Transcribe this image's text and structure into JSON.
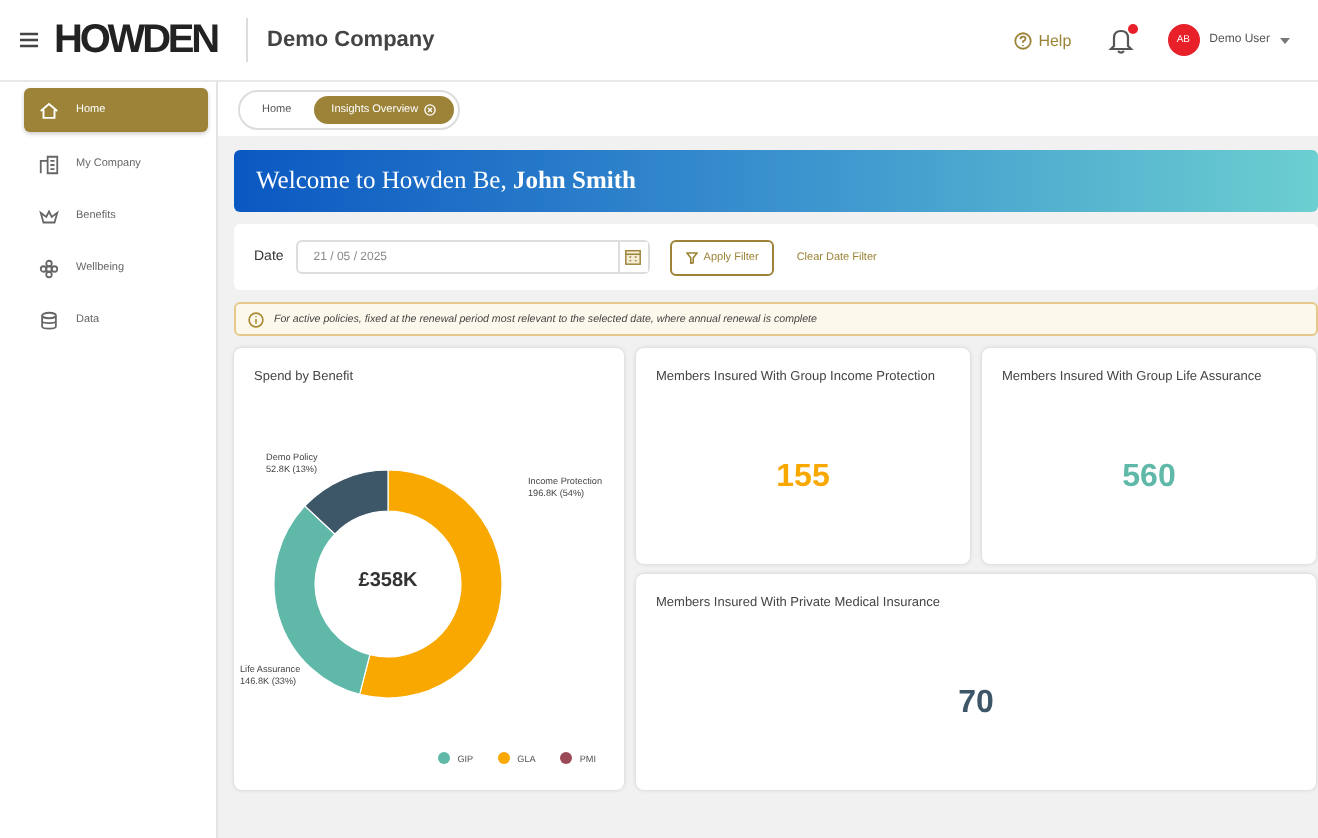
{
  "header": {
    "logo": "HOWDEN",
    "company": "Demo Company",
    "help": "Help",
    "notifications": {
      "unread": true
    },
    "user": {
      "initials": "AB",
      "name": "Demo User"
    }
  },
  "sidebar": {
    "items": [
      {
        "label": "Home",
        "selected": true
      },
      {
        "label": "My Company",
        "selected": false
      },
      {
        "label": "Benefits",
        "selected": false
      },
      {
        "label": "Wellbeing",
        "selected": false
      },
      {
        "label": "Data",
        "selected": false
      }
    ]
  },
  "tabs": [
    {
      "label": "Home",
      "selected": false,
      "closable": false
    },
    {
      "label": "Insights Overview",
      "selected": true,
      "closable": true
    }
  ],
  "banner": {
    "text": "Welcome to Howden Be, **John Smith**"
  },
  "filter": {
    "label": "Date",
    "date": "21 / 05 / 2025",
    "apply": "Apply Filter",
    "clear": "Clear Date Filter"
  },
  "notice": "For active policies, fixed at the renewal period most relevant to the selected date, where annual renewal is complete",
  "spend_card": {
    "title": "Spend by Benefit",
    "total": "£358K",
    "chart_data": {
      "type": "donut",
      "categories": [
        "Income Protection",
        "Life Assurance",
        "Demo Policy"
      ],
      "values": [
        54,
        33,
        13
      ],
      "value_labels": [
        "196.8K (54%)",
        "146.8K (33%)",
        "52.8K (13%)"
      ],
      "colors": [
        "#f9a800",
        "#5fb8a8",
        "#3d5668"
      ]
    },
    "legend": [
      {
        "label": "GIP",
        "color": "#5fb8a8"
      },
      {
        "label": "GLA",
        "color": "#f9a800"
      },
      {
        "label": "PMI",
        "color": "#9a4a55"
      }
    ]
  },
  "stat_cards": [
    {
      "title": "Members Insured With Group Income Protection",
      "value": "155",
      "color": "#f9a800",
      "wide": false
    },
    {
      "title": "Members Insured With Group Life Assurance",
      "value": "560",
      "color": "#5fb8a8",
      "wide": false
    },
    {
      "title": "Members Insured With Private Medical Insurance",
      "value": "70",
      "color": "#3d5668",
      "wide": true
    }
  ]
}
